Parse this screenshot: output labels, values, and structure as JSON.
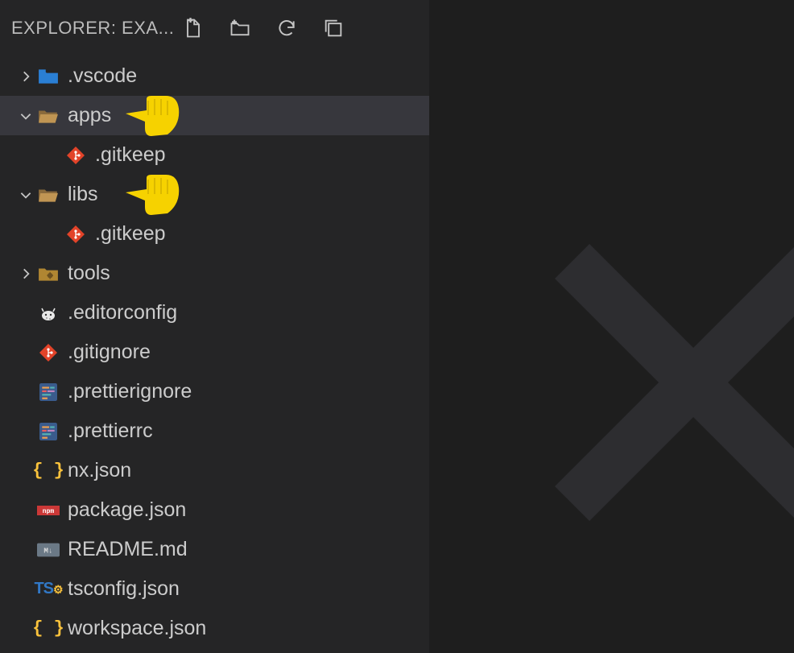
{
  "header": {
    "title": "EXPLORER: EXA...",
    "actions": {
      "newFile": "New File",
      "newFolder": "New Folder",
      "refresh": "Refresh",
      "collapse": "Collapse All"
    }
  },
  "tree": {
    "items": [
      {
        "name": ".vscode",
        "type": "folder",
        "expanded": false,
        "indent": 0,
        "icon": "vscode-folder"
      },
      {
        "name": "apps",
        "type": "folder",
        "expanded": true,
        "indent": 0,
        "icon": "folder-open",
        "selected": true,
        "pointer": true
      },
      {
        "name": ".gitkeep",
        "type": "file",
        "indent": 1,
        "icon": "git"
      },
      {
        "name": "libs",
        "type": "folder",
        "expanded": true,
        "indent": 0,
        "icon": "folder-open",
        "pointer": true
      },
      {
        "name": ".gitkeep",
        "type": "file",
        "indent": 1,
        "icon": "git"
      },
      {
        "name": "tools",
        "type": "folder",
        "expanded": false,
        "indent": 0,
        "icon": "tools-folder"
      },
      {
        "name": ".editorconfig",
        "type": "file",
        "indent": 0,
        "icon": "editorconfig"
      },
      {
        "name": ".gitignore",
        "type": "file",
        "indent": 0,
        "icon": "git"
      },
      {
        "name": ".prettierignore",
        "type": "file",
        "indent": 0,
        "icon": "prettier"
      },
      {
        "name": ".prettierrc",
        "type": "file",
        "indent": 0,
        "icon": "prettier"
      },
      {
        "name": "nx.json",
        "type": "file",
        "indent": 0,
        "icon": "json"
      },
      {
        "name": "package.json",
        "type": "file",
        "indent": 0,
        "icon": "npm"
      },
      {
        "name": "README.md",
        "type": "file",
        "indent": 0,
        "icon": "md"
      },
      {
        "name": "tsconfig.json",
        "type": "file",
        "indent": 0,
        "icon": "ts"
      },
      {
        "name": "workspace.json",
        "type": "file",
        "indent": 0,
        "icon": "json"
      }
    ]
  },
  "colors": {
    "git": "#e24329",
    "folder": "#c09553",
    "vscode": "#2a7fd4",
    "json": "#f9c23c",
    "npm": "#cb3837",
    "ts": "#3178c6",
    "md": "#6b7986",
    "prettier": "#3a5b8c",
    "tools": "#b08632",
    "pointer": "#f6d200"
  }
}
